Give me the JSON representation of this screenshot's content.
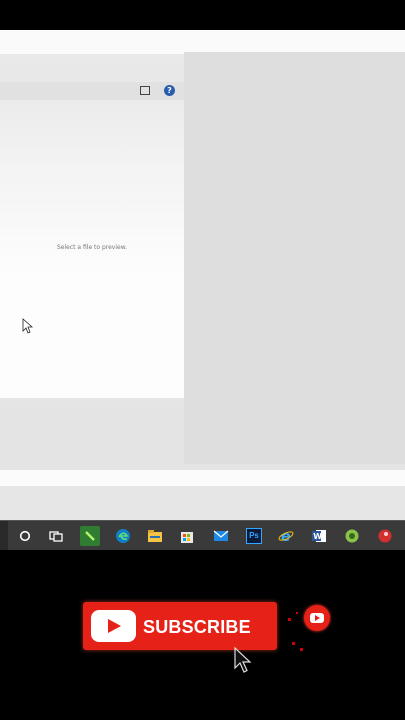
{
  "preview": {
    "message": "Select a file to preview."
  },
  "toolbar_icons": [
    "window-icon",
    "help-icon"
  ],
  "taskbar": {
    "items": [
      {
        "name": "cortana-icon"
      },
      {
        "name": "task-view-icon"
      },
      {
        "name": "green-app-icon"
      },
      {
        "name": "edge-icon"
      },
      {
        "name": "file-explorer-icon"
      },
      {
        "name": "store-icon"
      },
      {
        "name": "mail-icon"
      },
      {
        "name": "photoshop-icon",
        "text": "Ps"
      },
      {
        "name": "internet-explorer-icon"
      },
      {
        "name": "word-icon"
      },
      {
        "name": "green-circle-app-icon"
      },
      {
        "name": "red-app-icon"
      }
    ]
  },
  "overlay": {
    "subscribe_label": "SUBSCRIBE",
    "accent": "#e62117"
  }
}
